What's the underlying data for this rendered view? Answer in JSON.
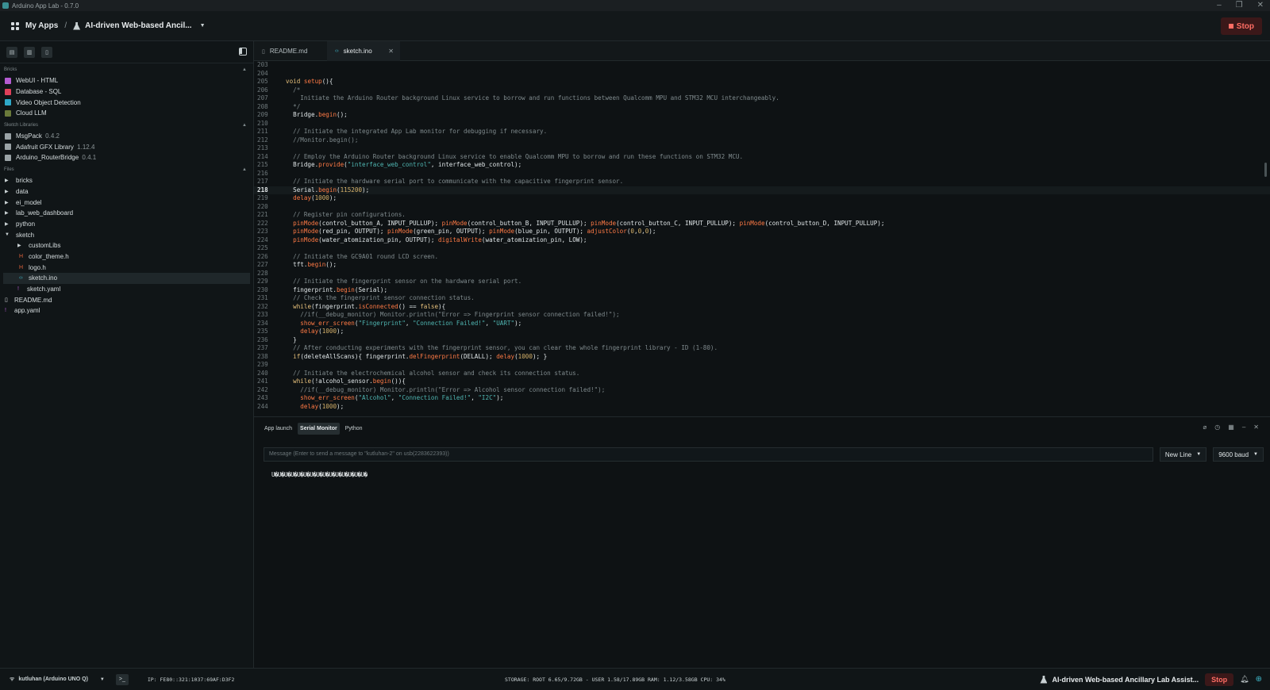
{
  "window": {
    "title": "Arduino App Lab - 0.7.0"
  },
  "header": {
    "my_apps": "My Apps",
    "separator": "/",
    "app_name": "AI-driven Web-based Ancil...",
    "stop_label": "Stop"
  },
  "sidebar": {
    "bricks_title": "Bricks",
    "bricks": [
      {
        "label": "WebUI - HTML",
        "color": "#b45bd1"
      },
      {
        "label": "Database - SQL",
        "color": "#e0405a"
      },
      {
        "label": "Video Object Detection",
        "color": "#2fa9c9"
      },
      {
        "label": "Cloud LLM",
        "color": "#6a7a3a"
      }
    ],
    "libs_title": "Sketch Libraries",
    "libraries": [
      {
        "label": "MsgPack",
        "version": "0.4.2"
      },
      {
        "label": "Adafruit GFX Library",
        "version": "1.12.4"
      },
      {
        "label": "Arduino_RouterBridge",
        "version": "0.4.1"
      }
    ],
    "files_title": "Files",
    "folders": [
      "bricks",
      "data",
      "ei_model",
      "lab_web_dashboard",
      "python",
      "sketch"
    ],
    "sketch_children": [
      "customLibs",
      "color_theme.h",
      "logo.h",
      "sketch.ino",
      "sketch.yaml"
    ],
    "root_files": [
      "README.md",
      "app.yaml"
    ]
  },
  "tabs": [
    {
      "label": "README.md"
    },
    {
      "label": "sketch.ino"
    }
  ],
  "editor": {
    "lines": [
      {
        "n": "203",
        "code": ""
      },
      {
        "n": "204",
        "code": ""
      },
      {
        "n": "205",
        "code": "void setup(){"
      },
      {
        "n": "206",
        "code": "  /*"
      },
      {
        "n": "207",
        "code": "    Initiate the Arduino Router background Linux service to borrow and run functions between Qualcomm MPU and STM32 MCU interchangeably."
      },
      {
        "n": "208",
        "code": "  */"
      },
      {
        "n": "209",
        "code": "  Bridge.begin();"
      },
      {
        "n": "210",
        "code": ""
      },
      {
        "n": "211",
        "code": "  // Initiate the integrated App Lab monitor for debugging if necessary."
      },
      {
        "n": "212",
        "code": "  //Monitor.begin();"
      },
      {
        "n": "213",
        "code": ""
      },
      {
        "n": "214",
        "code": "  // Employ the Arduino Router background Linux service to enable Qualcomm MPU to borrow and run these functions on STM32 MCU."
      },
      {
        "n": "215",
        "code": "  Bridge.provide(\"interface_web_control\", interface_web_control);"
      },
      {
        "n": "216",
        "code": ""
      },
      {
        "n": "217",
        "code": "  // Initiate the hardware serial port to communicate with the capacitive fingerprint sensor."
      },
      {
        "n": "218",
        "code": "  Serial.begin(115200);"
      },
      {
        "n": "219",
        "code": "  delay(1000);"
      },
      {
        "n": "220",
        "code": ""
      },
      {
        "n": "221",
        "code": "  // Register pin configurations."
      },
      {
        "n": "222",
        "code": "  pinMode(control_button_A, INPUT_PULLUP); pinMode(control_button_B, INPUT_PULLUP); pinMode(control_button_C, INPUT_PULLUP); pinMode(control_button_D, INPUT_PULLUP);"
      },
      {
        "n": "223",
        "code": "  pinMode(red_pin, OUTPUT); pinMode(green_pin, OUTPUT); pinMode(blue_pin, OUTPUT); adjustColor(0,0,0);"
      },
      {
        "n": "224",
        "code": "  pinMode(water_atomization_pin, OUTPUT); digitalWrite(water_atomization_pin, LOW);"
      },
      {
        "n": "225",
        "code": ""
      },
      {
        "n": "226",
        "code": "  // Initiate the GC9A01 round LCD screen."
      },
      {
        "n": "227",
        "code": "  tft.begin();"
      },
      {
        "n": "228",
        "code": ""
      },
      {
        "n": "229",
        "code": "  // Initiate the fingerprint sensor on the hardware serial port."
      },
      {
        "n": "230",
        "code": "  fingerprint.begin(Serial);"
      },
      {
        "n": "231",
        "code": "  // Check the fingerprint sensor connection status."
      },
      {
        "n": "232",
        "code": "  while(fingerprint.isConnected() == false){"
      },
      {
        "n": "233",
        "code": "    //if(__debug_monitor) Monitor.println(\"Error => Fingerprint sensor connection failed!\");"
      },
      {
        "n": "234",
        "code": "    show_err_screen(\"Fingerprint\", \"Connection Failed!\", \"UART\");"
      },
      {
        "n": "235",
        "code": "    delay(1000);"
      },
      {
        "n": "236",
        "code": "  }"
      },
      {
        "n": "237",
        "code": "  // After conducting experiments with the fingerprint sensor, you can clear the whole fingerprint library - ID (1-80)."
      },
      {
        "n": "238",
        "code": "  if(deleteAllScans){ fingerprint.delFingerprint(DELALL); delay(1000); }"
      },
      {
        "n": "239",
        "code": ""
      },
      {
        "n": "240",
        "code": "  // Initiate the electrochemical alcohol sensor and check its connection status."
      },
      {
        "n": "241",
        "code": "  while(!alcohol_sensor.begin()){"
      },
      {
        "n": "242",
        "code": "    //if(__debug_monitor) Monitor.println(\"Error => Alcohol sensor connection failed!\");"
      },
      {
        "n": "243",
        "code": "    show_err_screen(\"Alcohol\", \"Connection Failed!\", \"I2C\");"
      },
      {
        "n": "244",
        "code": "    delay(1000);"
      }
    ],
    "current_line": "218"
  },
  "bottom": {
    "tabs": [
      "App launch",
      "Serial Monitor",
      "Python"
    ],
    "active_tab": "Serial Monitor",
    "message_placeholder": "Message (Enter to send a message to \"kutluhan-2\" on usb(2283622393))",
    "line_ending": "New Line",
    "baud": "9600 baud",
    "serial_output": "U�U�U�U�U�U�U�U�U�U�U�U�U�U�U�"
  },
  "status": {
    "board": "kutluhan (Arduino UNO Q)",
    "ip": "IP: FE80::321:1037:69AF:D3F2",
    "stats": "STORAGE: ROOT 6.65/9.72GB - USER 1.58/17.89GB   RAM: 1.12/3.58GB   CPU: 34%",
    "app_name": "AI-driven Web-based Ancillary Lab Assist...",
    "stop_label": "Stop"
  }
}
